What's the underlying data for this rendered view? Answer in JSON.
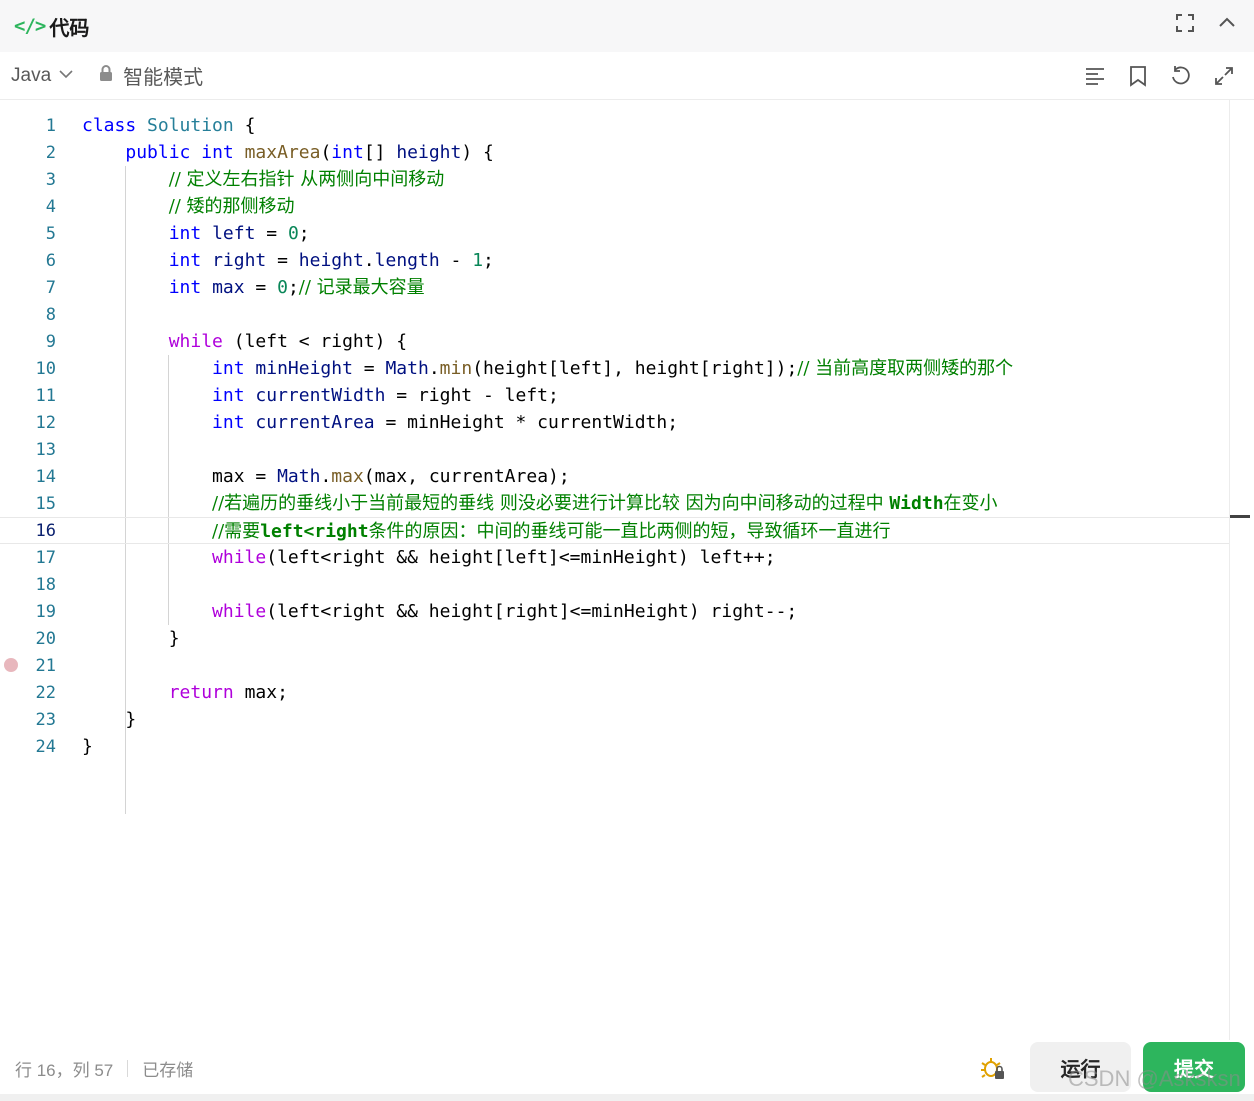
{
  "header": {
    "icon": "code-icon",
    "title": "代码"
  },
  "toolbar": {
    "language": "Java",
    "mode": "智能模式"
  },
  "editor": {
    "current_line": 16,
    "lines": [
      {
        "n": "1"
      },
      {
        "n": "2"
      },
      {
        "n": "3"
      },
      {
        "n": "4"
      },
      {
        "n": "5"
      },
      {
        "n": "6"
      },
      {
        "n": "7"
      },
      {
        "n": "8"
      },
      {
        "n": "9"
      },
      {
        "n": "10"
      },
      {
        "n": "11"
      },
      {
        "n": "12"
      },
      {
        "n": "13"
      },
      {
        "n": "14"
      },
      {
        "n": "15"
      },
      {
        "n": "16"
      },
      {
        "n": "17"
      },
      {
        "n": "18"
      },
      {
        "n": "19"
      },
      {
        "n": "20"
      },
      {
        "n": "21"
      },
      {
        "n": "22"
      },
      {
        "n": "23"
      },
      {
        "n": "24"
      }
    ],
    "code": [
      "class Solution {",
      "    public int maxArea(int[] height) {",
      "        // 定义左右指针 从两侧向中间移动",
      "        // 矮的那侧移动",
      "        int left = 0;",
      "        int right = height.length - 1;",
      "        int max = 0;// 记录最大容量",
      "",
      "        while (left < right) {",
      "            int minHeight = Math.min(height[left], height[right]);// 当前高度取两侧矮的那个",
      "            int currentWidth = right - left;",
      "            int currentArea = minHeight * currentWidth;",
      "",
      "            max = Math.max(max, currentArea);",
      "            //若遍历的垂线小于当前最短的垂线 则没必要进行计算比较 因为向中间移动的过程中 Width在变小",
      "            //需要left<right条件的原因：中间的垂线可能一直比两侧的短，导致循环一直进行",
      "            while(left<right && height[left]<=minHeight) left++;",
      "",
      "            while(left<right && height[right]<=minHeight) right--;",
      "        }",
      "",
      "        return max;",
      "    }",
      "}"
    ]
  },
  "footer": {
    "position": "行 16，列 57",
    "save_status": "已存储",
    "run_label": "运行",
    "submit_label": "提交",
    "watermark": "CSDN @Asksksn"
  },
  "colors": {
    "accent": "#2db55d",
    "line_number": "#237893",
    "keyword": "#0000ff",
    "control_keyword": "#af00db",
    "comment": "#008000"
  }
}
